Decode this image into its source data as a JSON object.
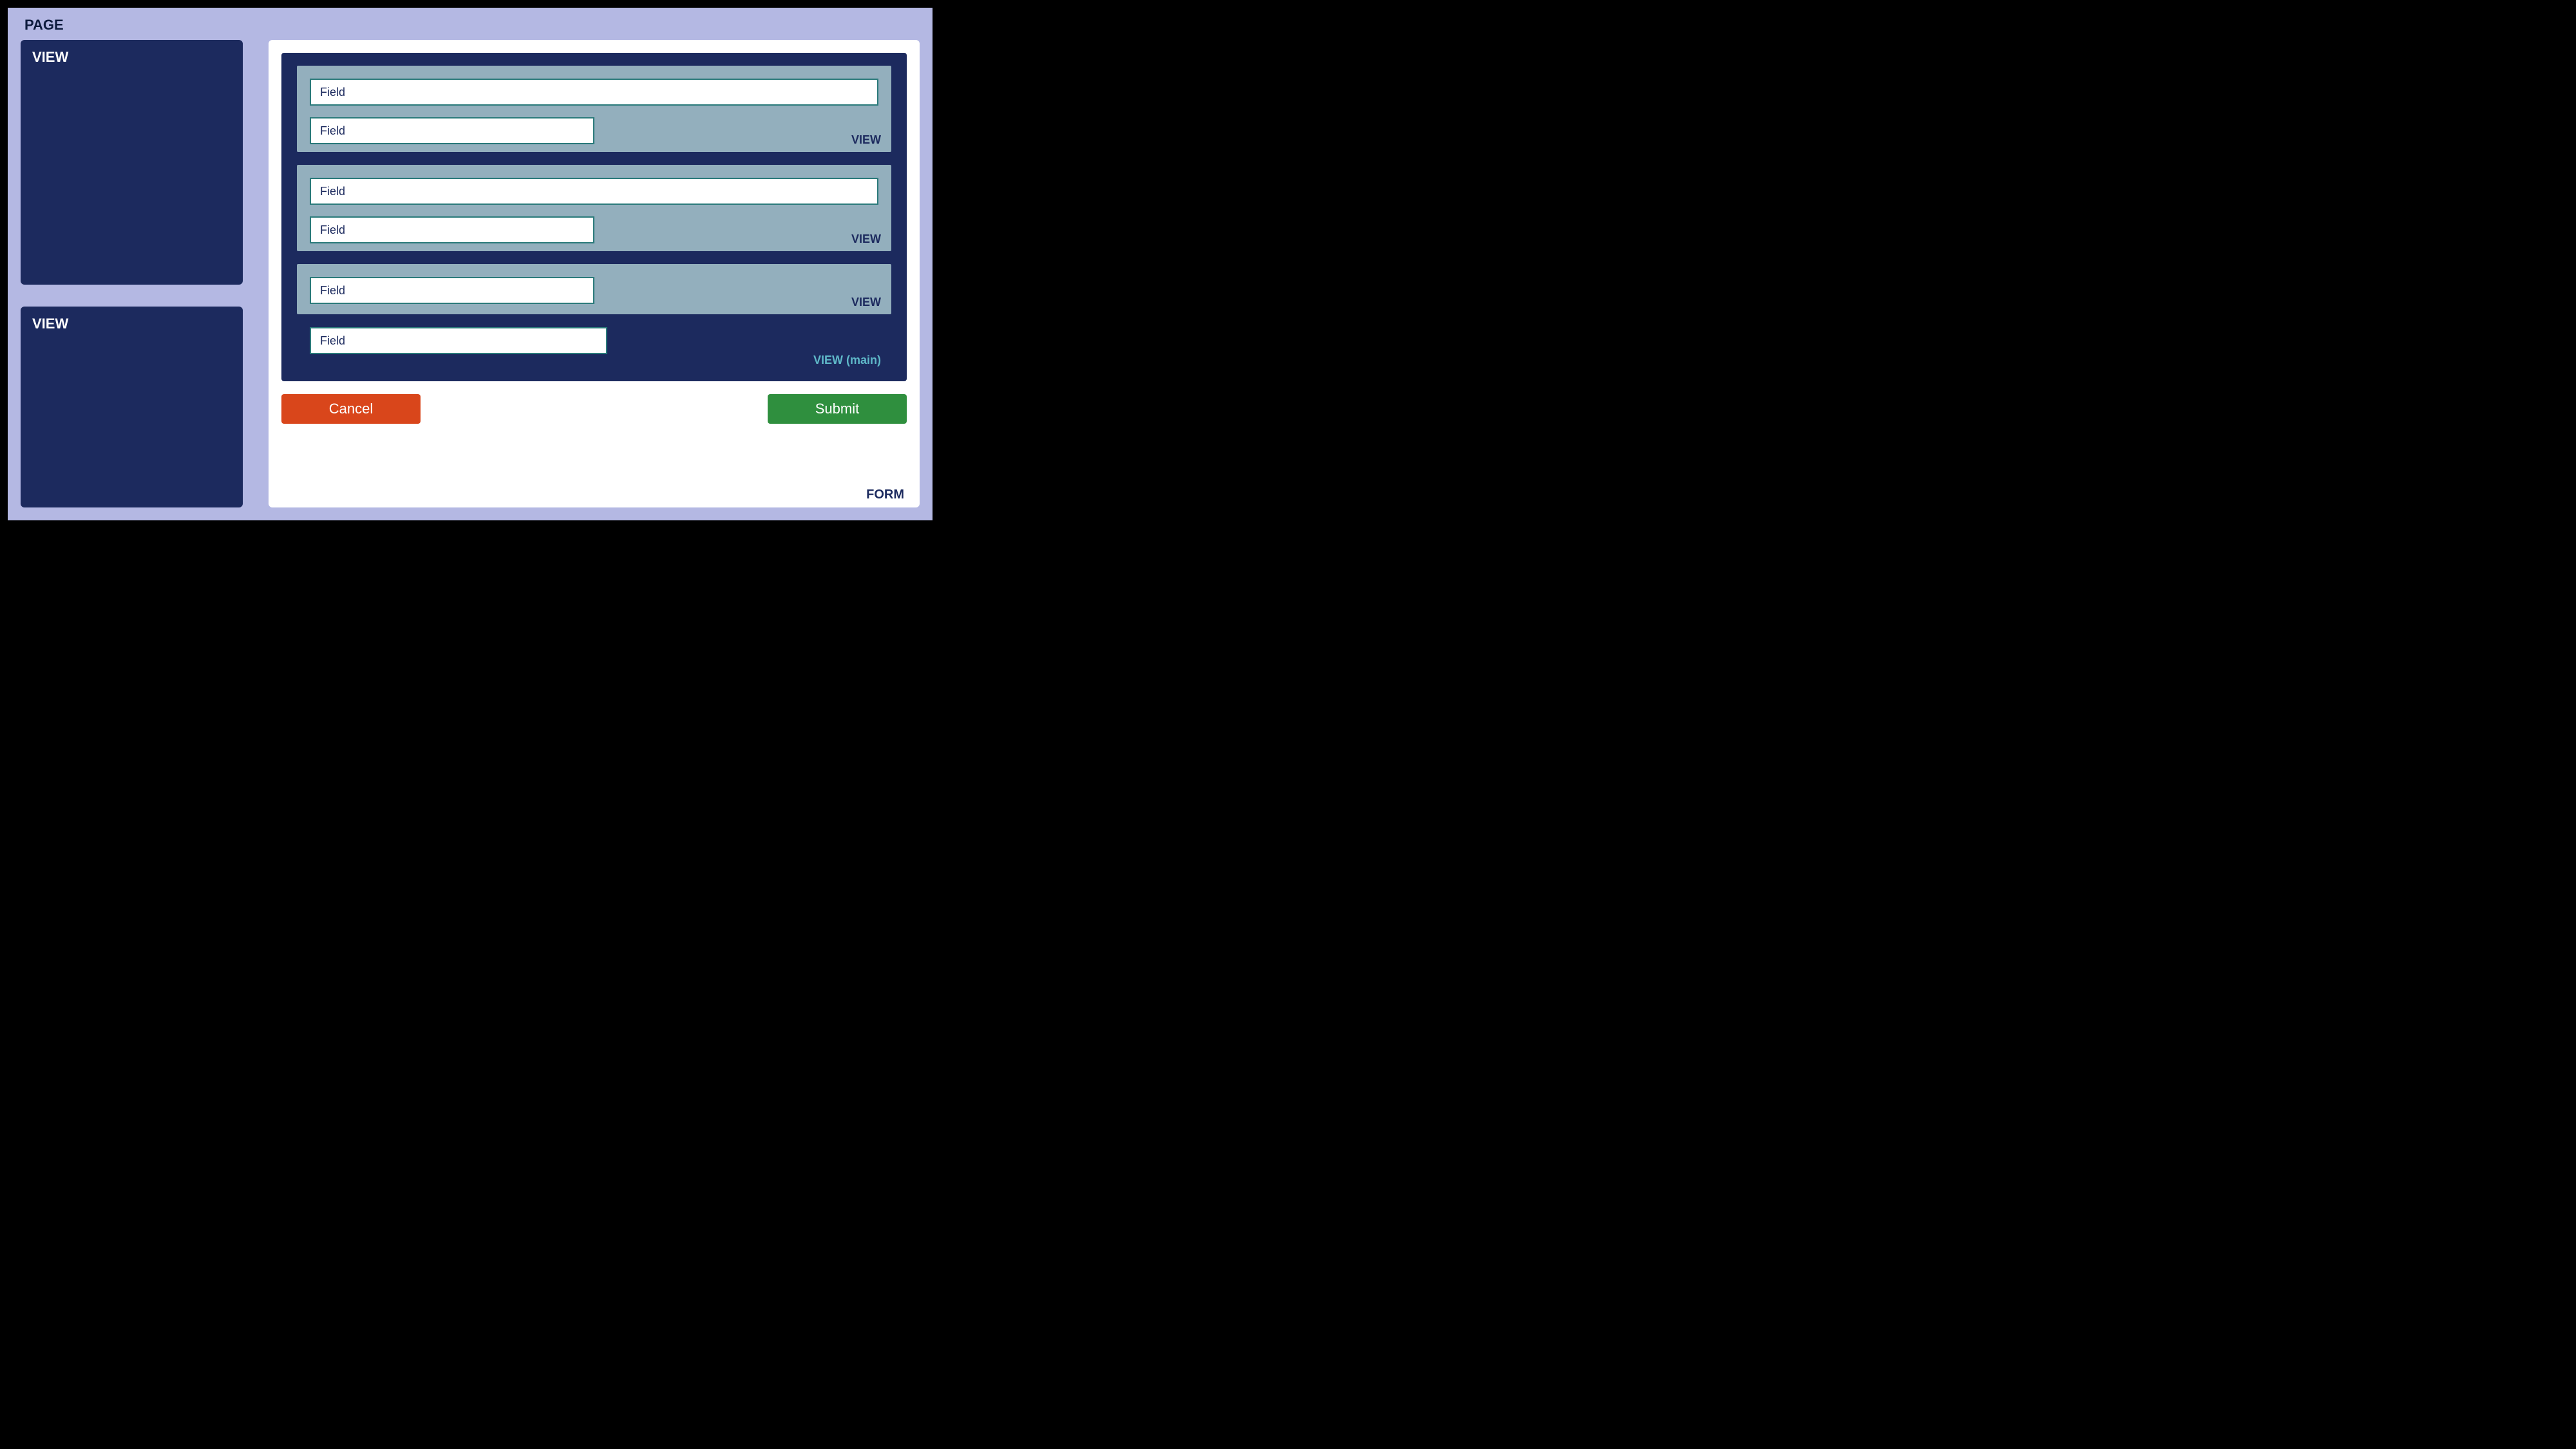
{
  "page": {
    "label": "PAGE"
  },
  "sidebar": {
    "views": [
      {
        "label": "VIEW"
      },
      {
        "label": "VIEW"
      }
    ]
  },
  "form": {
    "label": "FORM",
    "main_view_label": "VIEW (main)",
    "sub_views": [
      {
        "label": "VIEW",
        "fields": [
          {
            "label": "Field",
            "width": "full"
          },
          {
            "label": "Field",
            "width": "half"
          }
        ]
      },
      {
        "label": "VIEW",
        "fields": [
          {
            "label": "Field",
            "width": "full"
          },
          {
            "label": "Field",
            "width": "half"
          }
        ]
      },
      {
        "label": "VIEW",
        "fields": [
          {
            "label": "Field",
            "width": "half"
          }
        ]
      }
    ],
    "main_extra_field": {
      "label": "Field",
      "width": "half"
    },
    "buttons": {
      "cancel": "Cancel",
      "submit": "Submit"
    }
  }
}
